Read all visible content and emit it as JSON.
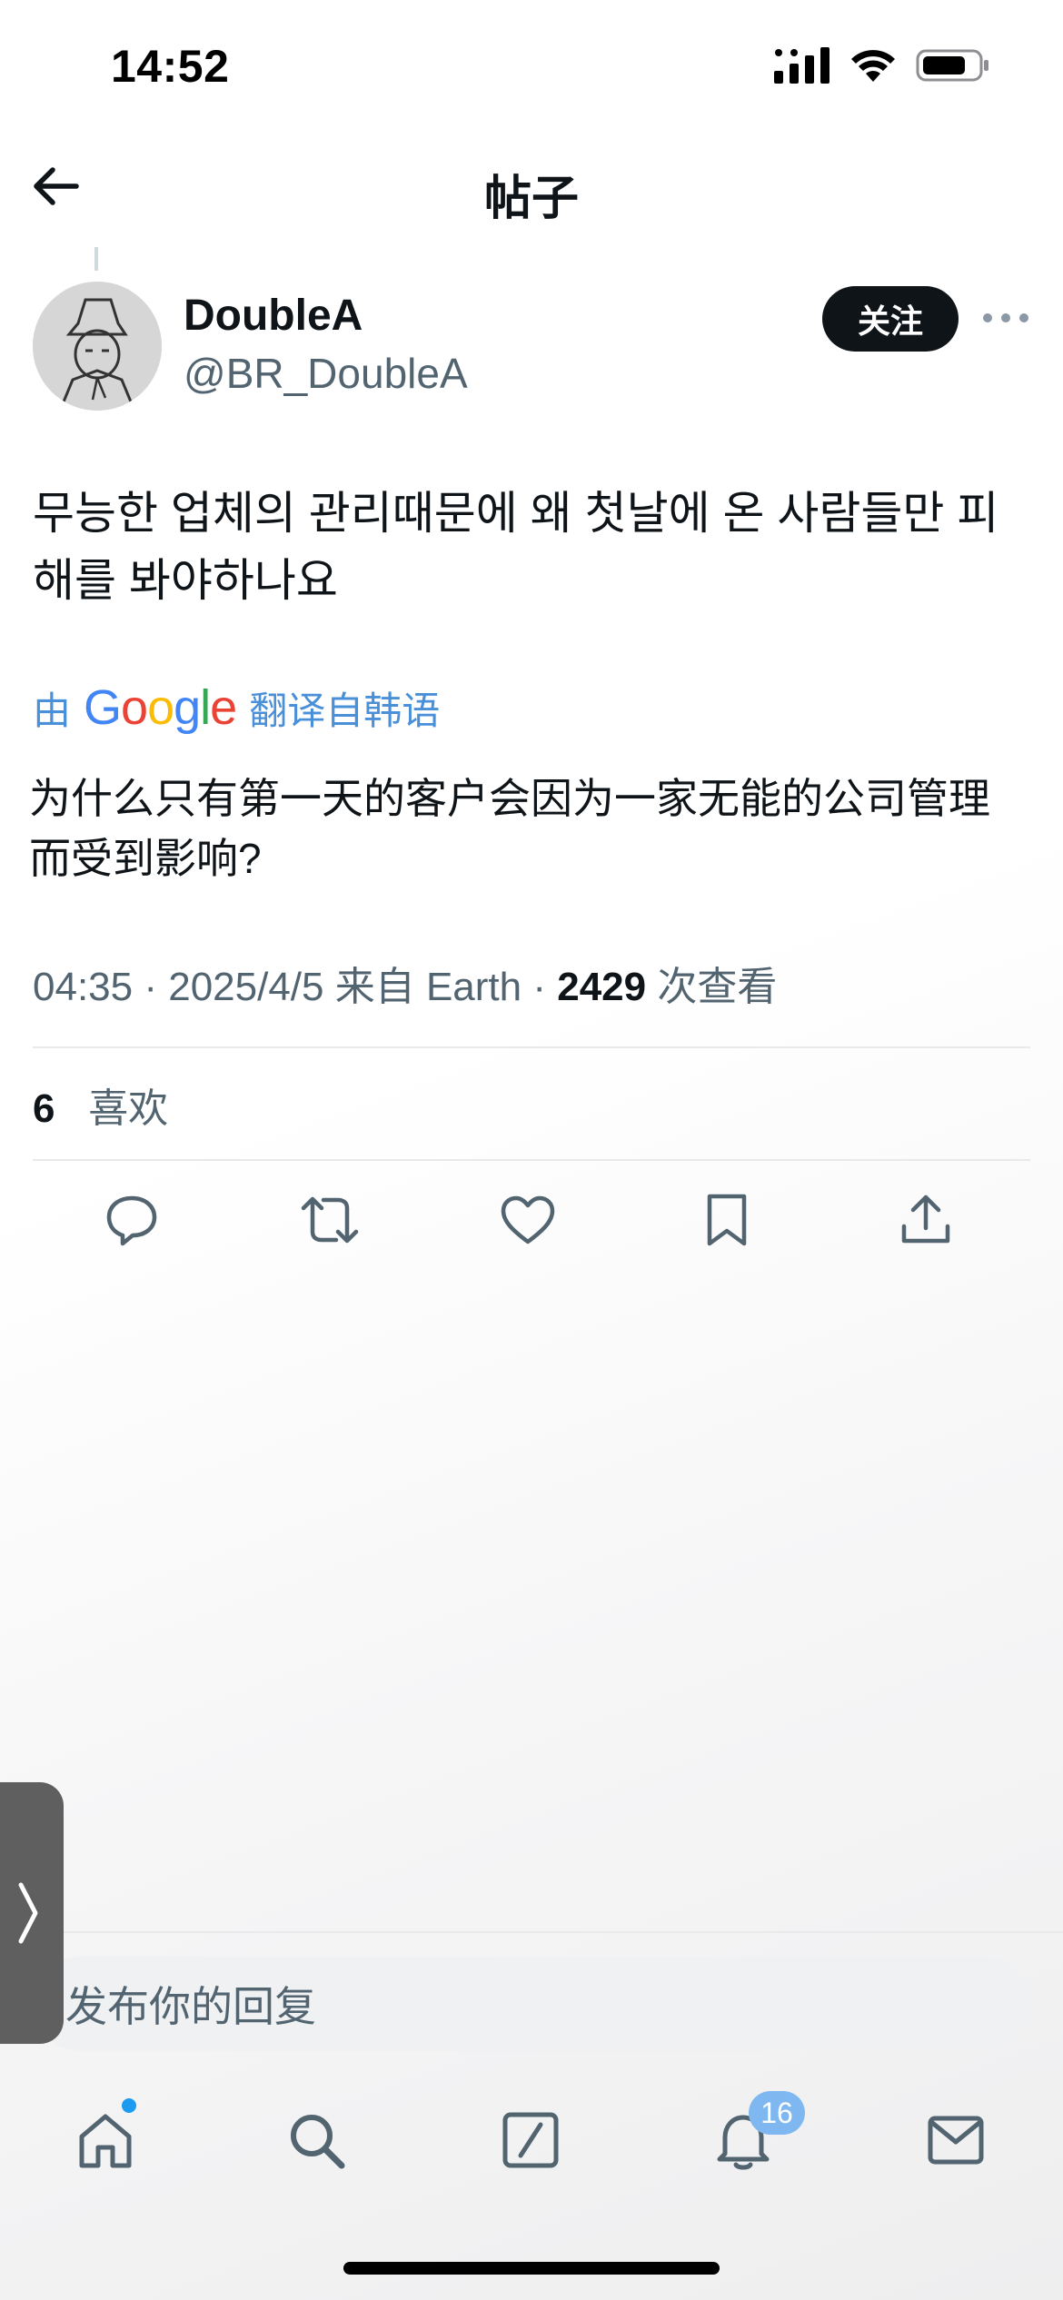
{
  "status_bar": {
    "time": "14:52"
  },
  "nav": {
    "title": "帖子",
    "back_icon": "arrow-left-icon"
  },
  "author": {
    "display_name": "DoubleA",
    "handle": "@BR_DoubleA",
    "follow_label": "关注"
  },
  "post": {
    "text": "무능한 업체의 관리때문에 왜 첫날에 온 사람들만 피해를 봐야하나요",
    "translate_prefix": "由",
    "translate_brand": "Google",
    "translate_suffix": "翻译自韩语",
    "translated_text": "为什么只有第一天的客户会因为一家无能的公司管理而受到影响?"
  },
  "meta": {
    "time": "04:35",
    "date": "2025/4/5",
    "source": "来自 Earth",
    "views_count": "2429",
    "views_label": "次查看"
  },
  "likes": {
    "count": "6",
    "label": "喜欢"
  },
  "actions": [
    "reply-icon",
    "repost-icon",
    "like-icon",
    "bookmark-icon",
    "share-icon"
  ],
  "reply": {
    "placeholder": "发布你的回复"
  },
  "tab_bar": {
    "items": [
      "home-icon",
      "search-icon",
      "compose-icon",
      "notifications-icon",
      "messages-icon"
    ],
    "notification_badge": "16"
  },
  "colors": {
    "accent": "#1d9bf0",
    "text_primary": "#0f1419",
    "text_secondary": "#536471",
    "follow_button": "#0f1419",
    "badge": "#7fb8f0",
    "translate_link": "#4a90d9"
  }
}
